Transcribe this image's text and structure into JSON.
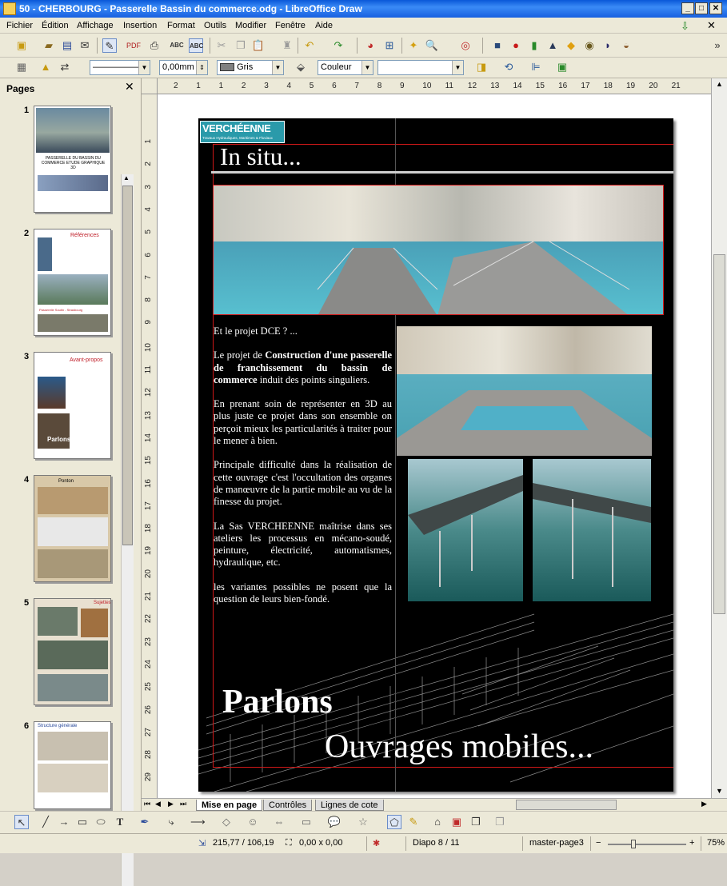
{
  "window": {
    "title": "50 - CHERBOURG - Passerelle Bassin du commerce.odg - LibreOffice Draw"
  },
  "menu": [
    "Fichier",
    "Édition",
    "Affichage",
    "Insertion",
    "Format",
    "Outils",
    "Modifier",
    "Fenêtre",
    "Aide"
  ],
  "toolbar2": {
    "line_width": "0,00mm",
    "area_color": "Gris",
    "area_style": "Couleur"
  },
  "pages_panel": {
    "title": "Pages",
    "pages": [
      {
        "num": "1",
        "caption": "PASSERELLE DU BASSIN DU COMMERCE ETUDE GRAPHIQUE 3D"
      },
      {
        "num": "2",
        "caption": "Références",
        "caption2": "Passerelle Soutin - Strasbourg"
      },
      {
        "num": "3",
        "caption": "Avant-propos",
        "caption2": "Parlons"
      },
      {
        "num": "4",
        "caption": "Ponton"
      },
      {
        "num": "5",
        "caption": "Sujettes"
      },
      {
        "num": "6",
        "caption": "Structure générale"
      }
    ]
  },
  "ruler": {
    "h": [
      "2",
      "1",
      "1",
      "2",
      "3",
      "4",
      "5",
      "6",
      "7",
      "8",
      "9",
      "10",
      "11",
      "12",
      "13",
      "14",
      "15",
      "16",
      "17",
      "18",
      "19",
      "20",
      "21"
    ],
    "v": [
      "1",
      "2",
      "3",
      "4",
      "5",
      "6",
      "7",
      "8",
      "9",
      "10",
      "11",
      "12",
      "13",
      "14",
      "15",
      "16",
      "17",
      "18",
      "19",
      "20",
      "21",
      "22",
      "23",
      "24",
      "25",
      "26",
      "27",
      "28",
      "29"
    ]
  },
  "slide": {
    "logo": "VERCHÉENNE",
    "logo_sub": "Travaux Hydrauliques, Maritimes & Fluviaux",
    "heading": "In situ...",
    "body": [
      "Et le projet DCE ? ...",
      "Le projet de Construction d'une passerelle de franchissement du bassin de commerce induit des points singuliers.",
      "En prenant soin de représenter en 3D au plus juste ce projet dans son ensemble on perçoit mieux les particularités à traiter pour le mener à bien.",
      "Principale difficulté dans la réalisation de cette ouvrage c'est l'occultation des organes de manœuvre de la partie mobile au vu de la finesse du projet.",
      "La Sas VERCHEENNE maîtrise dans ses ateliers les processus en mécano-soudé, peinture, électricité, automatismes, hydraulique, etc.",
      "les variantes possibles ne posent que la question de leurs bien-fondé."
    ],
    "bold_phrase": "Construction d'une passerelle de franchissement du bassin de commerce",
    "footer_1": "Parlons",
    "footer_2": "Ouvrages mobiles..."
  },
  "tabs": [
    "Mise en page",
    "Contrôles",
    "Lignes de cote"
  ],
  "status": {
    "position": "215,77 / 106,19",
    "size": "0,00 x 0,00",
    "slide": "Diapo 8 / 11",
    "master": "master-page3",
    "zoom": "75%"
  }
}
